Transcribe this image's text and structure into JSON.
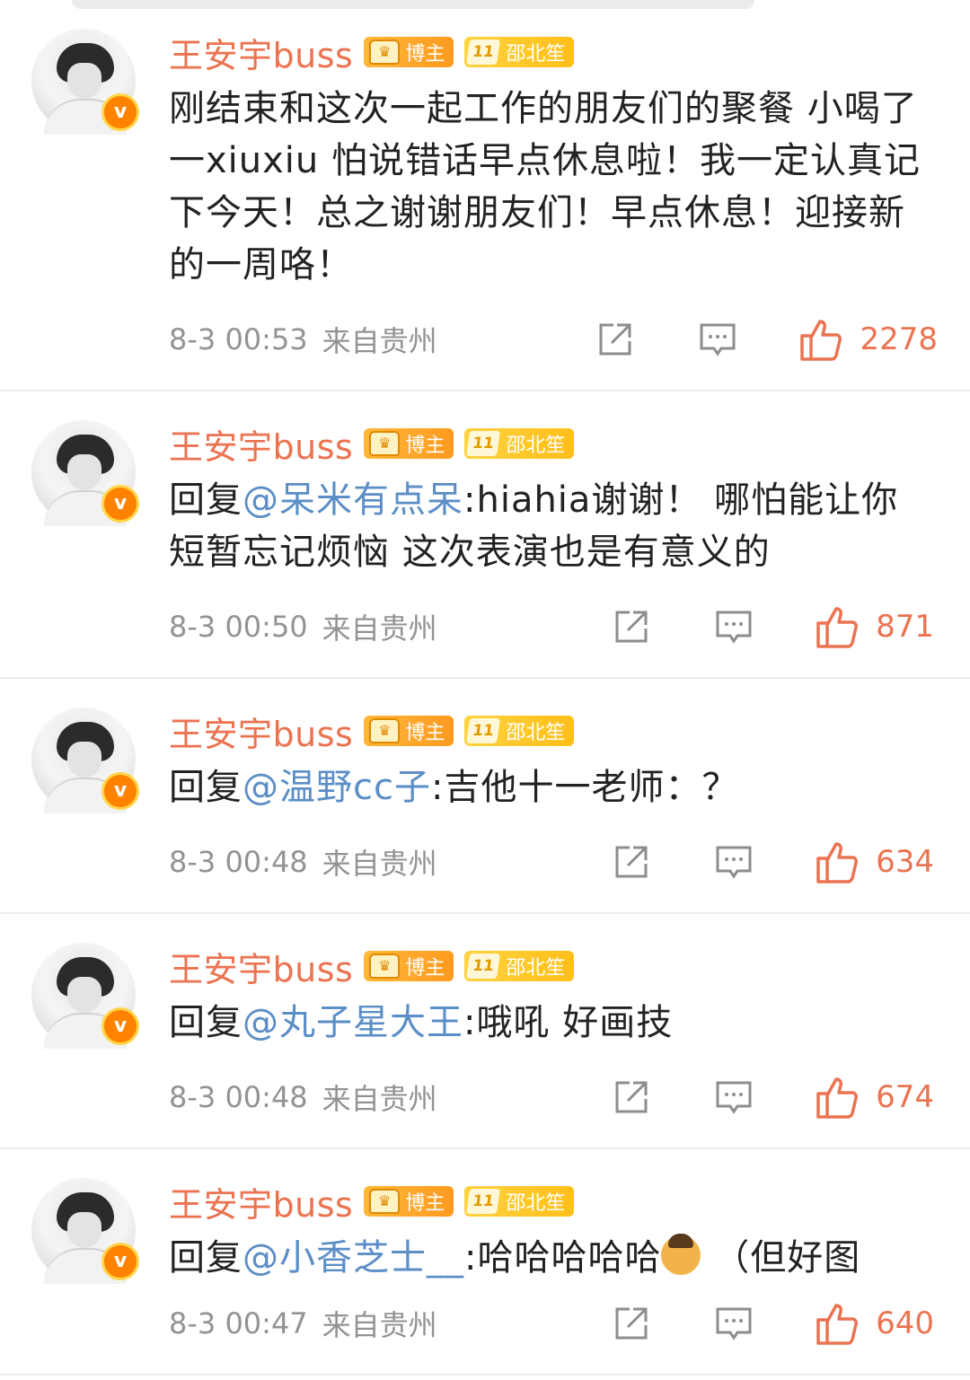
{
  "comments": [
    {
      "username": "王安宇buss",
      "badge_host": "博主",
      "badge_fan_level": "11",
      "badge_fan_name": "邵北笙",
      "prefix": "",
      "mention": "",
      "text": "刚结束和这次一起工作的朋友们的聚餐 小喝了一xiuxiu 怕说错话早点休息啦！我一定认真记下今天！总之谢谢朋友们！早点休息！迎接新的一周咯！",
      "time": "8-3 00:53",
      "location": "来自贵州",
      "likes": "2278"
    },
    {
      "username": "王安宇buss",
      "badge_host": "博主",
      "badge_fan_level": "11",
      "badge_fan_name": "邵北笙",
      "prefix": "回复",
      "mention": "@呆米有点呆",
      "text": ":hiahia谢谢！ 哪怕能让你短暂忘记烦恼 这次表演也是有意义的",
      "time": "8-3 00:50",
      "location": "来自贵州",
      "likes": "871"
    },
    {
      "username": "王安宇buss",
      "badge_host": "博主",
      "badge_fan_level": "11",
      "badge_fan_name": "邵北笙",
      "prefix": "回复",
      "mention": "@温野cc子",
      "text": ":吉他十一老师：？",
      "time": "8-3 00:48",
      "location": "来自贵州",
      "likes": "634"
    },
    {
      "username": "王安宇buss",
      "badge_host": "博主",
      "badge_fan_level": "11",
      "badge_fan_name": "邵北笙",
      "prefix": "回复",
      "mention": "@丸子星大王",
      "text": ":哦吼 好画技",
      "time": "8-3 00:48",
      "location": "来自贵州",
      "likes": "674"
    },
    {
      "username": "王安宇buss",
      "badge_host": "博主",
      "badge_fan_level": "11",
      "badge_fan_name": "邵北笙",
      "prefix": "回复",
      "mention": "@小香芝士__",
      "text": ":哈哈哈哈哈",
      "text_after_emoji": " （但好图",
      "time": "8-3 00:47",
      "location": "来自贵州",
      "likes": "640"
    }
  ],
  "colors": {
    "username": "#eb7350",
    "mention": "#5b8ec7",
    "meta": "#939393",
    "like": "#eb7350"
  },
  "icons": {
    "share": "share-icon",
    "comment": "comment-icon",
    "like": "thumbs-up-icon",
    "verified": "verified-v-icon"
  }
}
